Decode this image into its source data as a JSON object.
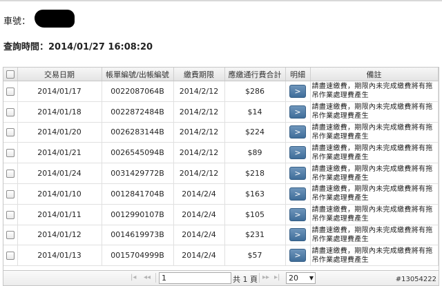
{
  "vehicle": {
    "label": "車號："
  },
  "query": {
    "label": "查詢時間：",
    "value": "2014/01/27 16:08:20"
  },
  "table": {
    "headers": [
      "交易日期",
      "帳單編號/出帳編號",
      "繳費期限",
      "應繳通行費合計",
      "明細",
      "備註"
    ],
    "detail_button": ">",
    "rows": [
      {
        "date": "2014/01/17",
        "bill": "0022087064B",
        "due": "2014/2/12",
        "amount": "$286",
        "note": "請盡速繳費，期限內未完成繳費將有拖吊作業處理費產生"
      },
      {
        "date": "2014/01/18",
        "bill": "0022872484B",
        "due": "2014/2/12",
        "amount": "$14",
        "note": "請盡速繳費，期限內未完成繳費將有拖吊作業處理費產生"
      },
      {
        "date": "2014/01/20",
        "bill": "0026283144B",
        "due": "2014/2/12",
        "amount": "$224",
        "note": "請盡速繳費，期限內未完成繳費將有拖吊作業處理費產生"
      },
      {
        "date": "2014/01/21",
        "bill": "0026545094B",
        "due": "2014/2/12",
        "amount": "$89",
        "note": "請盡速繳費，期限內未完成繳費將有拖吊作業處理費產生"
      },
      {
        "date": "2014/01/24",
        "bill": "0031429772B",
        "due": "2014/2/12",
        "amount": "$218",
        "note": "請盡速繳費，期限內未完成繳費將有拖吊作業處理費產生"
      },
      {
        "date": "2014/01/10",
        "bill": "0012841704B",
        "due": "2014/2/4",
        "amount": "$163",
        "note": "請盡速繳費，期限內未完成繳費將有拖吊作業處理費產生"
      },
      {
        "date": "2014/01/11",
        "bill": "0012990107B",
        "due": "2014/2/4",
        "amount": "$105",
        "note": "請盡速繳費，期限內未完成繳費將有拖吊作業處理費產生"
      },
      {
        "date": "2014/01/12",
        "bill": "0014619973B",
        "due": "2014/2/4",
        "amount": "$231",
        "note": "請盡速繳費，期限內未完成繳費將有拖吊作業處理費產生"
      },
      {
        "date": "2014/01/13",
        "bill": "0015704999B",
        "due": "2014/2/4",
        "amount": "$57",
        "note": "請盡速繳費，期限內未完成繳費將有拖吊作業處理費產生"
      }
    ]
  },
  "pager": {
    "first": "|◂",
    "prev": "◂◂",
    "page_value": "1",
    "total_text": "共 1 頁",
    "next": "▸▸",
    "last": "▸|",
    "page_size": "20"
  },
  "watermark": "#13054222"
}
